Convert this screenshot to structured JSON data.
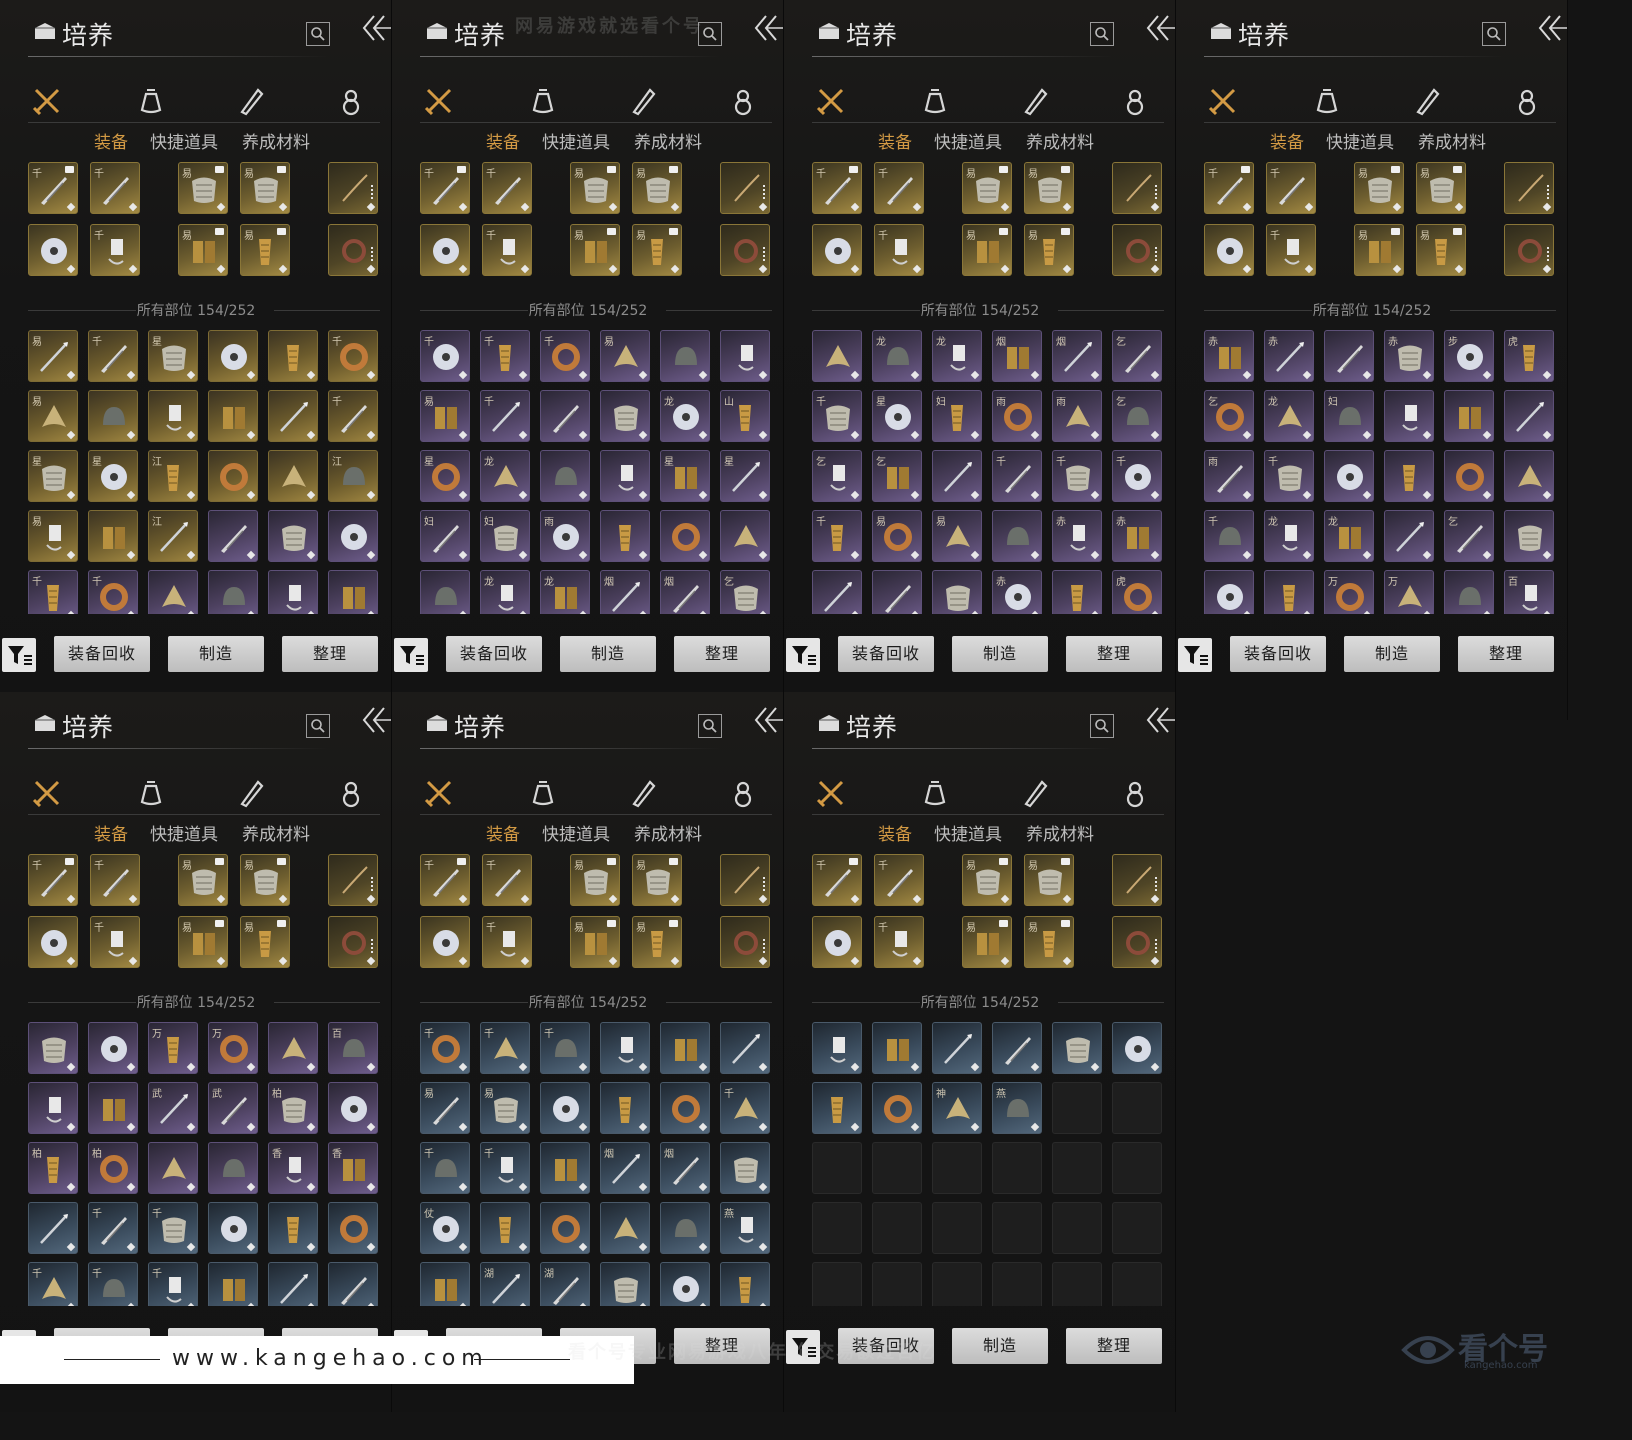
{
  "header": {
    "title": "培养"
  },
  "subtabs": [
    "装备",
    "快捷道具",
    "养成材料"
  ],
  "section_title": "所有部位 154/252",
  "buttons": {
    "recycle": "装备回收",
    "craft": "制造",
    "sort": "整理"
  },
  "categories": [
    "weapon-icon",
    "pouch-icon",
    "scroll-icon",
    "gourd-icon"
  ],
  "equipped": {
    "slots": [
      {
        "glyph": "千",
        "icon": "blade-icon",
        "tag": true,
        "ring": false
      },
      {
        "glyph": "千",
        "icon": "blade-icon",
        "tag": false,
        "ring": false
      },
      {
        "glyph": "易",
        "icon": "armor-icon",
        "tag": true,
        "ring": false
      },
      {
        "glyph": "易",
        "icon": "armor-icon",
        "tag": true,
        "ring": false
      },
      {
        "glyph": "",
        "icon": "bow-icon",
        "tag": false,
        "ring": true
      },
      {
        "glyph": "",
        "icon": "jade-disc-icon",
        "tag": false,
        "ring": false
      },
      {
        "glyph": "千",
        "icon": "pendant-icon",
        "tag": false,
        "ring": false
      },
      {
        "glyph": "易",
        "icon": "gauntlet-icon",
        "tag": true,
        "ring": false
      },
      {
        "glyph": "易",
        "icon": "greaves-icon",
        "tag": true,
        "ring": false
      },
      {
        "glyph": "",
        "icon": "bracelet-icon",
        "tag": false,
        "ring": true
      }
    ]
  },
  "panels": [
    {
      "tiers": [
        "gold",
        "gold",
        "gold",
        "gold",
        "gold",
        "gold",
        "gold",
        "gold",
        "gold",
        "gold",
        "gold",
        "gold",
        "gold",
        "gold",
        "gold",
        "gold",
        "gold",
        "gold",
        "gold",
        "gold",
        "gold",
        "purple",
        "purple",
        "purple",
        "purple",
        "purple",
        "purple",
        "purple",
        "purple",
        "purple"
      ],
      "glyphs": [
        "易",
        "千",
        "星",
        "",
        "",
        "千",
        "易",
        "",
        "",
        "",
        "",
        "千",
        "星",
        "星",
        "江",
        "",
        "",
        "江",
        "易",
        "",
        "江",
        "",
        "",
        "",
        "千",
        "千",
        "",
        "",
        "",
        ""
      ]
    },
    {
      "tiers": [
        "purple",
        "purple",
        "purple",
        "purple",
        "purple",
        "purple",
        "purple",
        "purple",
        "purple",
        "purple",
        "purple",
        "purple",
        "purple",
        "purple",
        "purple",
        "purple",
        "purple",
        "purple",
        "purple",
        "purple",
        "purple",
        "purple",
        "purple",
        "purple",
        "purple",
        "purple",
        "purple",
        "purple",
        "purple",
        "purple"
      ],
      "glyphs": [
        "千",
        "千",
        "千",
        "易",
        "",
        "",
        "易",
        "千",
        "",
        "",
        "龙",
        "山",
        "星",
        "龙",
        "",
        "",
        "星",
        "星",
        "妇",
        "妇",
        "雨",
        "",
        "",
        "",
        "",
        "龙",
        "龙",
        "烟",
        "烟",
        "乞"
      ]
    },
    {
      "tiers": [
        "purple",
        "purple",
        "purple",
        "purple",
        "purple",
        "purple",
        "purple",
        "purple",
        "purple",
        "purple",
        "purple",
        "purple",
        "purple",
        "purple",
        "purple",
        "purple",
        "purple",
        "purple",
        "purple",
        "purple",
        "purple",
        "purple",
        "purple",
        "purple",
        "purple",
        "purple",
        "purple",
        "purple",
        "purple",
        "purple"
      ],
      "glyphs": [
        "",
        "龙",
        "龙",
        "烟",
        "烟",
        "乞",
        "千",
        "星",
        "妇",
        "雨",
        "雨",
        "乞",
        "乞",
        "乞",
        "",
        "千",
        "千",
        "千",
        "千",
        "易",
        "易",
        "",
        "赤",
        "赤",
        "",
        "",
        "",
        "赤",
        "",
        "虎"
      ]
    },
    {
      "tiers": [
        "purple",
        "purple",
        "purple",
        "purple",
        "purple",
        "purple",
        "purple",
        "purple",
        "purple",
        "purple",
        "purple",
        "purple",
        "purple",
        "purple",
        "purple",
        "purple",
        "purple",
        "purple",
        "purple",
        "purple",
        "purple",
        "purple",
        "purple",
        "purple",
        "purple",
        "purple",
        "purple",
        "purple",
        "purple",
        "purple"
      ],
      "glyphs": [
        "赤",
        "赤",
        "",
        "赤",
        "步",
        "虎",
        "乞",
        "龙",
        "妇",
        "",
        "",
        "",
        "雨",
        "千",
        "",
        "",
        "",
        "",
        "千",
        "龙",
        "龙",
        "",
        "乞",
        "",
        "",
        "",
        "万",
        "万",
        "",
        "百"
      ]
    },
    {
      "tiers": [
        "purple",
        "purple",
        "purple",
        "purple",
        "purple",
        "purple",
        "purple",
        "purple",
        "purple",
        "purple",
        "purple",
        "purple",
        "purple",
        "purple",
        "purple",
        "purple",
        "purple",
        "purple",
        "blue",
        "blue",
        "blue",
        "blue",
        "blue",
        "blue",
        "blue",
        "blue",
        "blue",
        "blue",
        "blue",
        "blue"
      ],
      "glyphs": [
        "",
        "",
        "万",
        "万",
        "",
        "百",
        "",
        "",
        "武",
        "武",
        "柏",
        "",
        "柏",
        "柏",
        "",
        "",
        "香",
        "香",
        "",
        "千",
        "千",
        "",
        "",
        "",
        "千",
        "千",
        "千",
        "",
        "",
        ""
      ]
    },
    {
      "tiers": [
        "blue",
        "blue",
        "blue",
        "blue",
        "blue",
        "blue",
        "blue",
        "blue",
        "blue",
        "blue",
        "blue",
        "blue",
        "blue",
        "blue",
        "blue",
        "blue",
        "blue",
        "blue",
        "blue",
        "blue",
        "blue",
        "blue",
        "blue",
        "blue",
        "blue",
        "blue",
        "blue",
        "blue",
        "blue",
        "blue"
      ],
      "glyphs": [
        "千",
        "千",
        "千",
        "",
        "",
        "",
        "易",
        "易",
        "",
        "",
        "",
        "千",
        "千",
        "千",
        "",
        "烟",
        "烟",
        "",
        "仗",
        "",
        "",
        "",
        "",
        "燕",
        "",
        "湖",
        "湖",
        "",
        "",
        ""
      ]
    },
    {
      "tiers": [
        "blue",
        "blue",
        "blue",
        "blue",
        "blue",
        "blue",
        "blue",
        "blue",
        "blue",
        "blue",
        "empty",
        "empty",
        "empty",
        "empty",
        "empty",
        "empty",
        "empty",
        "empty",
        "empty",
        "empty",
        "empty",
        "empty",
        "empty",
        "empty",
        "empty",
        "empty",
        "empty",
        "empty",
        "empty",
        "empty"
      ],
      "glyphs": [
        "",
        "",
        "",
        "",
        "",
        "",
        "",
        "",
        "神",
        "燕",
        "",
        "",
        "",
        "",
        "",
        "",
        "",
        "",
        "",
        "",
        "",
        "",
        "",
        "",
        "",
        "",
        "",
        "",
        "",
        ""
      ]
    }
  ],
  "watermark": {
    "top": "网易游戏就选看个号",
    "site": "www.kangehao.com",
    "tagline": "看个号专业网易游戏八年 年交易额过百亿",
    "logo": "看个号",
    "logo_sub": "kangehao.com"
  }
}
